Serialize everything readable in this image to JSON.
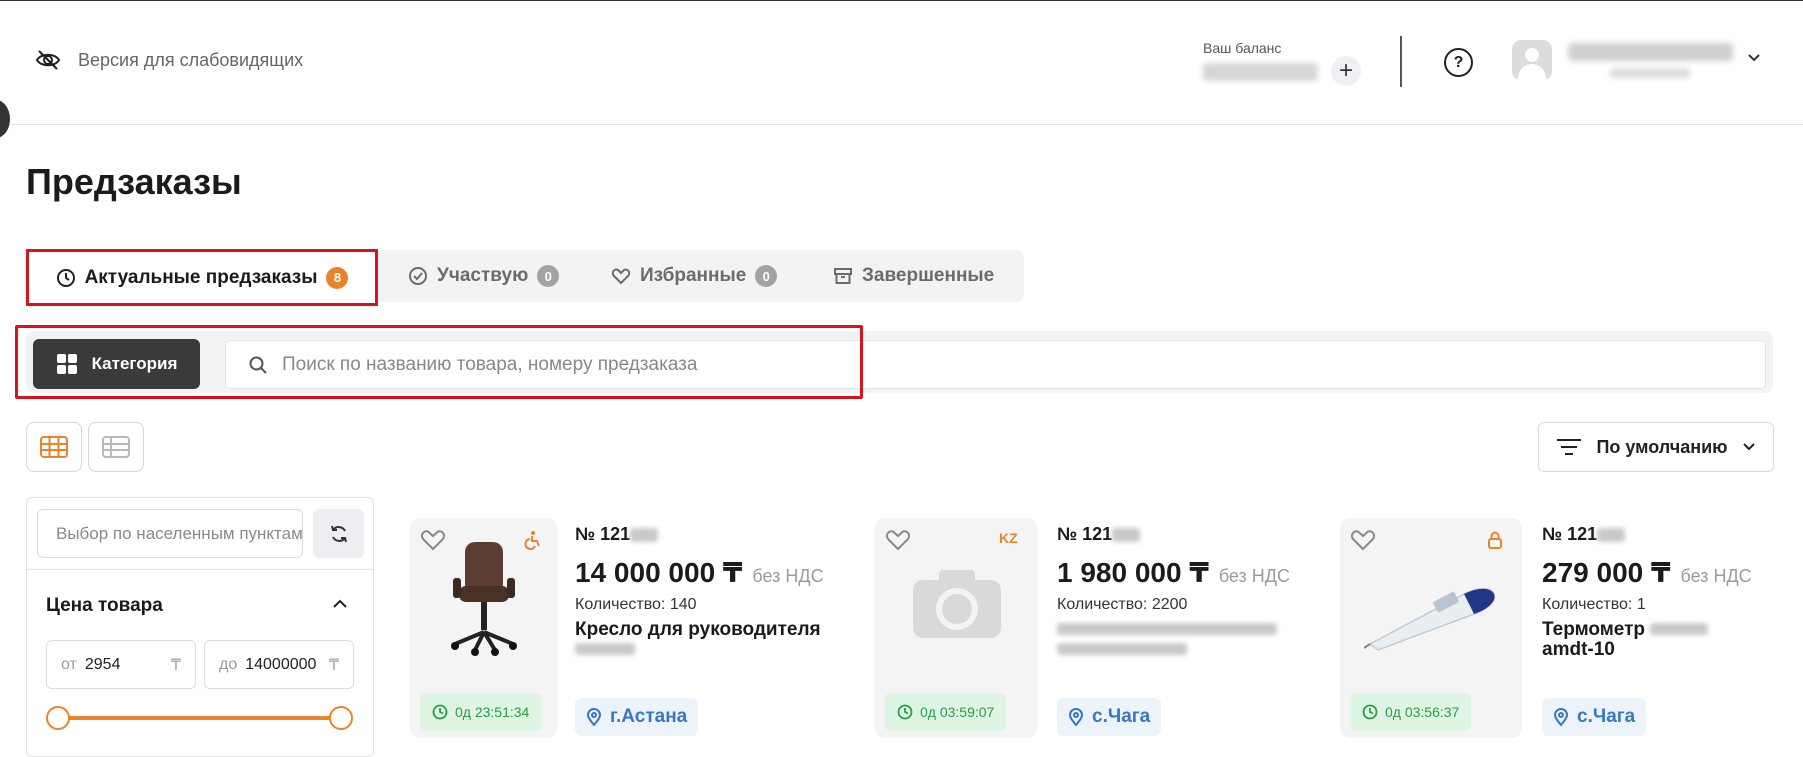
{
  "header": {
    "vision_label": "Версия для слабовидящих",
    "balance_label": "Ваш баланс",
    "balance_plus": "+",
    "help": "?"
  },
  "page": {
    "title": "Предзаказы"
  },
  "tabs": [
    {
      "label": "Актуальные предзаказы",
      "count": "8",
      "active": true
    },
    {
      "label": "Участвую",
      "count": "0"
    },
    {
      "label": "Избранные",
      "count": "0"
    },
    {
      "label": "Завершенные"
    }
  ],
  "filter": {
    "category_label": "Категория",
    "search_placeholder": "Поиск по названию товара, номеру предзаказа"
  },
  "sort": {
    "label": "По умолчанию"
  },
  "sidebar": {
    "location_placeholder": "Выбор по населенным пунктам",
    "price_title": "Цена товара",
    "price_from_label": "от",
    "price_from": "2954",
    "price_to_label": "до",
    "price_to": "14000000",
    "currency": "₸"
  },
  "cards": [
    {
      "number": "№ 121",
      "price": "14 000 000 ₸",
      "vat": "без НДС",
      "qty": "Количество: 140",
      "title": "Кресло для руководителя",
      "timer": "0д 23:51:34",
      "location": "г.Астана",
      "corner": "accessible-icon"
    },
    {
      "number": "№ 121",
      "price": "1 980 000 ₸",
      "vat": "без НДС",
      "qty": "Количество: 2200",
      "title": "",
      "timer": "0д 03:59:07",
      "location": "с.Чага",
      "corner": "KZ"
    },
    {
      "number": "№ 121",
      "price": "279 000 ₸",
      "vat": "без НДС",
      "qty": "Количество: 1",
      "title": "Термометр",
      "title2": "amdt-10",
      "timer": "0д 03:56:37",
      "location": "с.Чага",
      "corner": "lock-icon"
    }
  ],
  "colors": {
    "accent": "#e8852a",
    "highlight": "#d6141b",
    "timer_bg": "#dff5e3",
    "timer_text": "#2a9b49",
    "loc_text": "#3778c2"
  }
}
